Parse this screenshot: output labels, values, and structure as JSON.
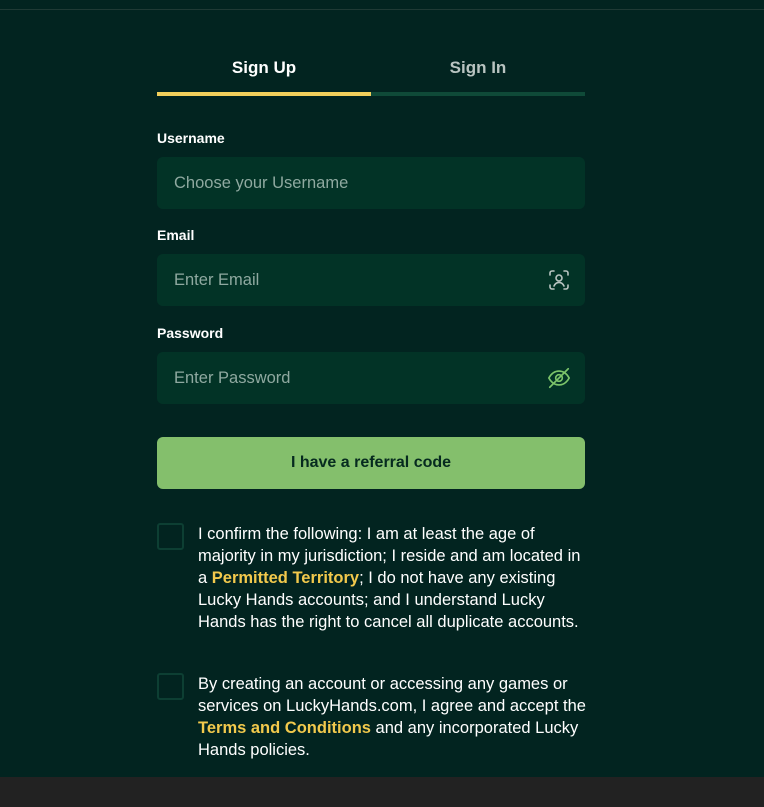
{
  "tabs": {
    "signup": "Sign Up",
    "signin": "Sign In"
  },
  "fields": {
    "username": {
      "label": "Username",
      "placeholder": "Choose your Username",
      "value": ""
    },
    "email": {
      "label": "Email",
      "placeholder": "Enter Email",
      "value": ""
    },
    "password": {
      "label": "Password",
      "placeholder": "Enter Password",
      "value": ""
    }
  },
  "referral_button": "I have a referral code",
  "consent1": {
    "text_before": "I confirm the following: I am at least the age of majority in my jurisdiction; I reside and am located in a ",
    "link": "Permitted Territory",
    "text_after": "; I do not have any existing Lucky Hands accounts; and I understand Lucky Hands has the right to cancel all duplicate accounts.",
    "checked": false
  },
  "consent2": {
    "text_before": "By creating an account or accessing any games or services on LuckyHands.com, I agree and accept the ",
    "link": "Terms and Conditions",
    "text_after": " and any incorporated Lucky Hands policies.",
    "checked": false
  },
  "colors": {
    "background": "#022420",
    "field": "#023326",
    "accent_yellow": "#f2cf5b",
    "button_green": "#84bf6c"
  },
  "icons": {
    "email": "contact-scan-icon",
    "password": "eye-off-icon"
  }
}
